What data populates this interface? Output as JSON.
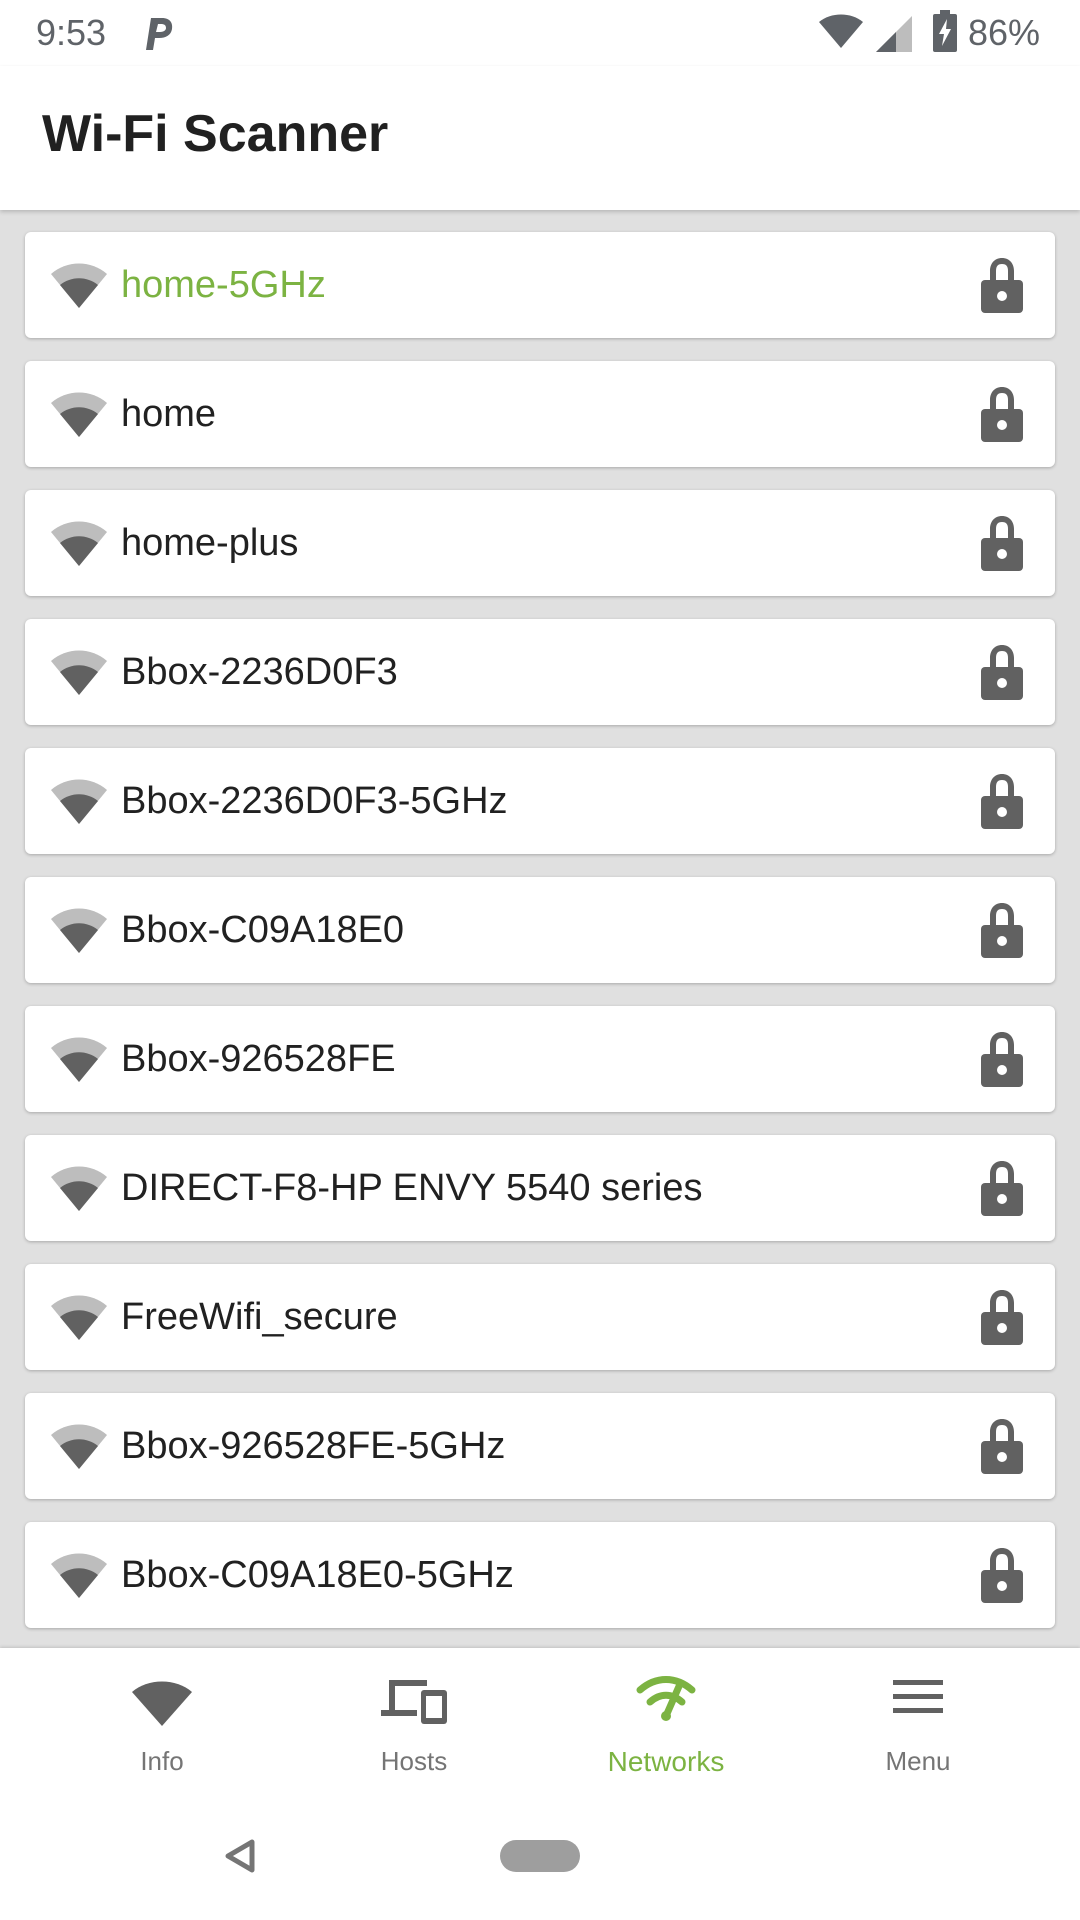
{
  "status_bar": {
    "time": "9:53",
    "battery_percent": "86%",
    "icons": [
      "parking-p-icon",
      "wifi-icon",
      "cell-signal-icon",
      "battery-charging-icon"
    ]
  },
  "app_bar": {
    "title": "Wi-Fi Scanner"
  },
  "networks": [
    {
      "name": "home-5GHz",
      "active": true,
      "secured": true
    },
    {
      "name": "home",
      "active": false,
      "secured": true
    },
    {
      "name": "home-plus",
      "active": false,
      "secured": true
    },
    {
      "name": "Bbox-2236D0F3",
      "active": false,
      "secured": true
    },
    {
      "name": "Bbox-2236D0F3-5GHz",
      "active": false,
      "secured": true
    },
    {
      "name": "Bbox-C09A18E0",
      "active": false,
      "secured": true
    },
    {
      "name": "Bbox-926528FE",
      "active": false,
      "secured": true
    },
    {
      "name": "DIRECT-F8-HP ENVY 5540 series",
      "active": false,
      "secured": true
    },
    {
      "name": "FreeWifi_secure",
      "active": false,
      "secured": true
    },
    {
      "name": "Bbox-926528FE-5GHz",
      "active": false,
      "secured": true
    },
    {
      "name": "Bbox-C09A18E0-5GHz",
      "active": false,
      "secured": true
    }
  ],
  "bottom_nav": {
    "items": [
      {
        "label": "Info",
        "icon": "wifi-icon",
        "active": false
      },
      {
        "label": "Hosts",
        "icon": "devices-icon",
        "active": false
      },
      {
        "label": "Networks",
        "icon": "network-scan-icon",
        "active": true
      },
      {
        "label": "Menu",
        "icon": "menu-icon",
        "active": false
      }
    ]
  },
  "colors": {
    "accent": "#7cb342",
    "icon_gray": "#616161",
    "list_background": "#e0e0e0"
  }
}
